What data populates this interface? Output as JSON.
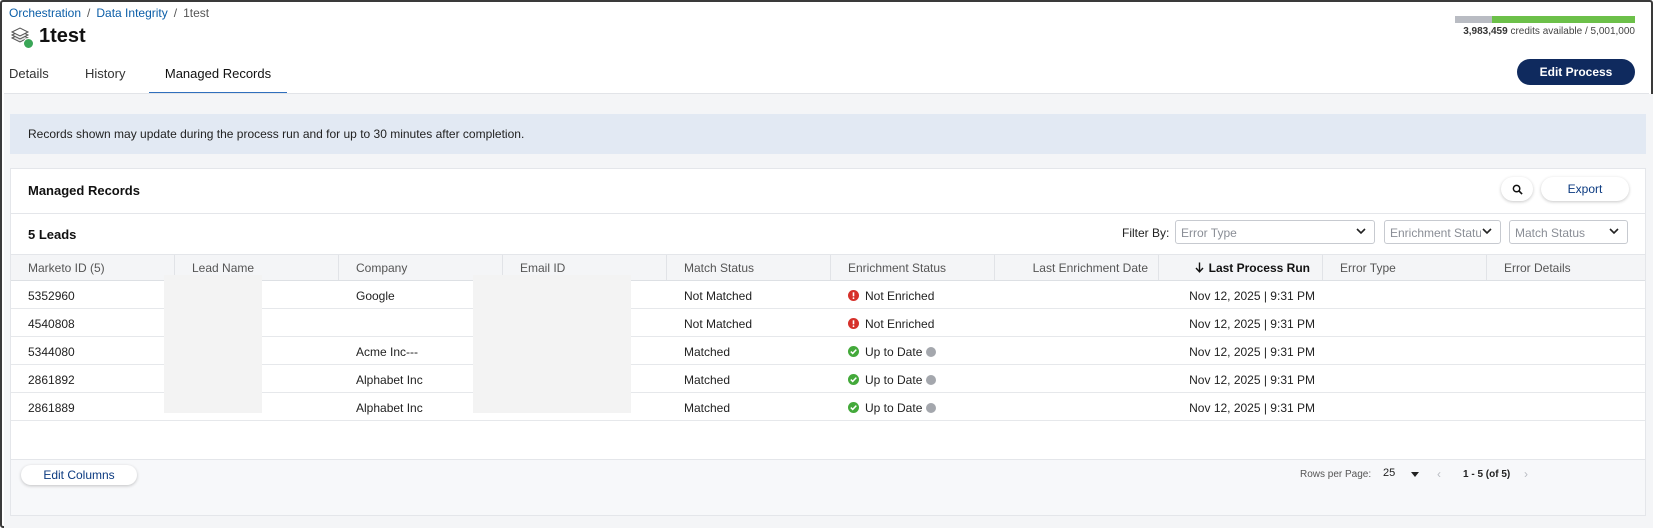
{
  "breadcrumb": {
    "items": [
      "Orchestration",
      "Data Integrity"
    ],
    "current": "1test",
    "separator": "/"
  },
  "page": {
    "title": "1test"
  },
  "credits": {
    "available": "3,983,459",
    "suffix": "credits available / 5,001,000",
    "fraction_available": 0.797
  },
  "tabs": [
    {
      "label": "Details",
      "active": false
    },
    {
      "label": "History",
      "active": false
    },
    {
      "label": "Managed Records",
      "active": true
    }
  ],
  "actions": {
    "edit_process": "Edit Process"
  },
  "banner": {
    "text": "Records shown may update during the process run and for up to 30 minutes after completion."
  },
  "card": {
    "title": "Managed Records",
    "export_label": "Export",
    "count_label": "5 Leads",
    "filter_label": "Filter By:",
    "filters": [
      {
        "placeholder": "Error Type"
      },
      {
        "placeholder": "Enrichment Status"
      },
      {
        "placeholder": "Match Status"
      }
    ]
  },
  "table": {
    "columns": [
      "Marketo ID (5)",
      "Lead Name",
      "Company",
      "Email ID",
      "Match Status",
      "Enrichment Status",
      "Last Enrichment Date",
      "Last Process Run",
      "Error Type",
      "Error Details"
    ],
    "rows": [
      {
        "id": "5352960",
        "lead_name": "",
        "company": "Google",
        "email": "",
        "match": "Not Matched",
        "enrichment": "Not Enriched",
        "enrich_state": "error",
        "last_enrich": "",
        "last_run": "Nov 12, 2025 | 9:31 PM",
        "error_type": "",
        "error_details": ""
      },
      {
        "id": "4540808",
        "lead_name": "",
        "company": "",
        "email": "",
        "match": "Not Matched",
        "enrichment": "Not Enriched",
        "enrich_state": "error",
        "last_enrich": "",
        "last_run": "Nov 12, 2025 | 9:31 PM",
        "error_type": "",
        "error_details": ""
      },
      {
        "id": "5344080",
        "lead_name": "",
        "company": "Acme Inc---",
        "email": "",
        "match": "Matched",
        "enrichment": "Up to Date",
        "enrich_state": "ok",
        "last_enrich": "",
        "last_run": "Nov 12, 2025 | 9:31 PM",
        "error_type": "",
        "error_details": ""
      },
      {
        "id": "2861892",
        "lead_name": "",
        "company": "Alphabet Inc",
        "email": "",
        "match": "Matched",
        "enrichment": "Up to Date",
        "enrich_state": "ok",
        "last_enrich": "",
        "last_run": "Nov 12, 2025 | 9:31 PM",
        "error_type": "",
        "error_details": ""
      },
      {
        "id": "2861889",
        "lead_name": "",
        "company": "Alphabet Inc",
        "email": "",
        "match": "Matched",
        "enrichment": "Up to Date",
        "enrich_state": "ok",
        "last_enrich": "",
        "last_run": "Nov 12, 2025 | 9:31 PM",
        "error_type": "",
        "error_details": ""
      }
    ]
  },
  "footer": {
    "edit_columns": "Edit Columns",
    "rows_per_page_label": "Rows per Page:",
    "rows_per_page_value": "25",
    "pagination_info": "1 - 5 (of 5)"
  },
  "colors": {
    "primary_button": "#0f2a5e",
    "link": "#0b5ea8",
    "status_error": "#d6312b",
    "status_ok": "#43a93a",
    "credit_used": "#b9bcc3",
    "credit_available": "#6cc049"
  },
  "icons": {
    "process": "process-stack-icon",
    "search": "search-icon",
    "dropdown": "chevron-down-icon",
    "sort": "arrow-down-icon",
    "error": "error-circle-icon",
    "ok": "check-circle-icon",
    "info": "info-icon"
  }
}
